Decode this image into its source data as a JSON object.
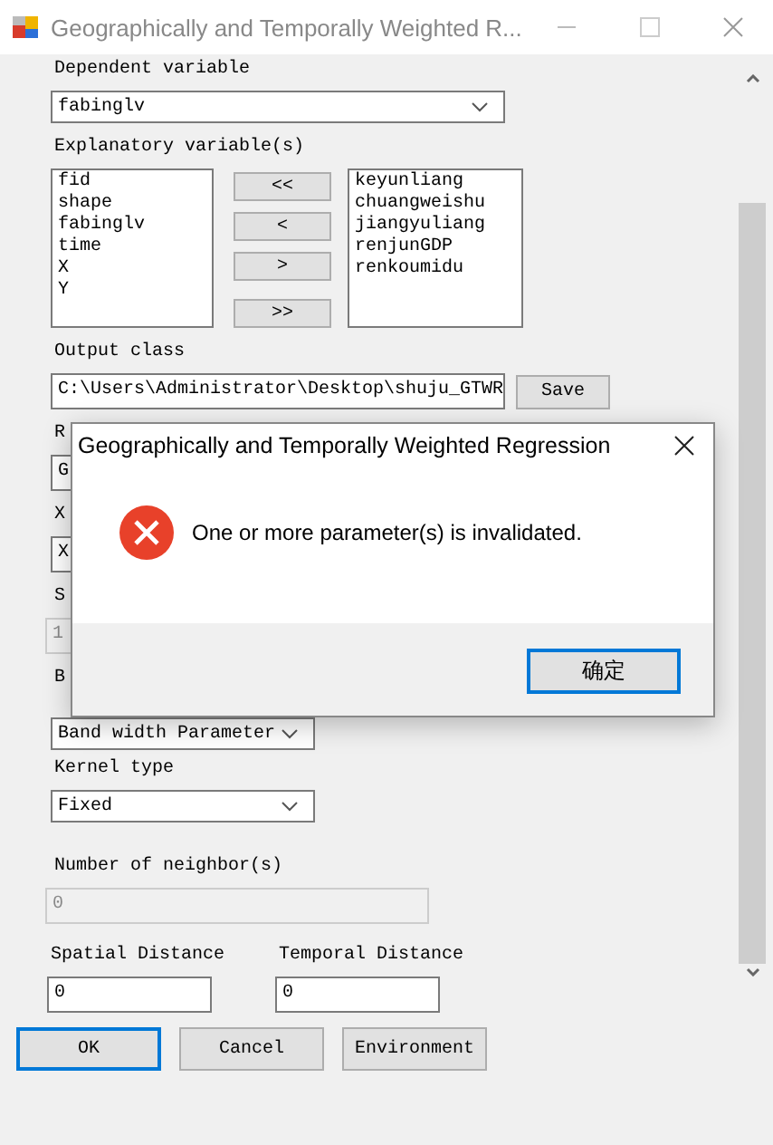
{
  "window": {
    "title": "Geographically and Temporally Weighted R..."
  },
  "form": {
    "rows": [
      {
        "kind": "label",
        "text": "Dependent variable"
      },
      {
        "kind": "combo",
        "text": "fabinglv"
      },
      {
        "kind": "label",
        "text": "Explanatory variable(s)"
      },
      {
        "kind": "lists",
        "available": [
          "fid",
          "shape",
          "fabinglv",
          "time",
          "X",
          "Y"
        ],
        "moves": [
          "<<",
          "<",
          ">",
          ">>"
        ],
        "chosen": [
          "keyunliang",
          "chuangweishu",
          "jiangyuliang",
          "renjunGDP",
          "renkoumidu"
        ]
      },
      {
        "kind": "label",
        "text": "Output class"
      },
      {
        "kind": "path",
        "text": "C:\\Users\\Administrator\\Desktop\\shuju_GTWR",
        "button": "Save"
      },
      {
        "kind": "label",
        "text": "R"
      },
      {
        "kind": "field",
        "text": "G",
        "disabled": false
      },
      {
        "kind": "label",
        "text": "X"
      },
      {
        "kind": "field",
        "text": "X",
        "disabled": false
      },
      {
        "kind": "label",
        "text": "S"
      },
      {
        "kind": "field",
        "text": "1",
        "disabled": true
      },
      {
        "kind": "label",
        "text": "B"
      },
      {
        "kind": "combo",
        "text": "Band width Parameter"
      },
      {
        "kind": "label",
        "text": "Kernel type"
      },
      {
        "kind": "combo",
        "text": "Fixed"
      },
      {
        "kind": "label",
        "text": "Number of neighbor(s)"
      },
      {
        "kind": "field",
        "text": "0",
        "disabled": true
      },
      {
        "kind": "pair",
        "items": [
          {
            "label": "Spatial Distance",
            "value": "0"
          },
          {
            "label": "Temporal Distance",
            "value": "0"
          }
        ]
      }
    ]
  },
  "buttons": [
    {
      "label": "OK",
      "focused": true
    },
    {
      "label": "Cancel",
      "focused": false
    },
    {
      "label": "Environment",
      "focused": false
    }
  ],
  "dialog": {
    "title": "Geographically and Temporally Weighted Regression",
    "message": "One or more parameter(s) is invalidated.",
    "button": {
      "label": "确定",
      "focused": true
    }
  }
}
